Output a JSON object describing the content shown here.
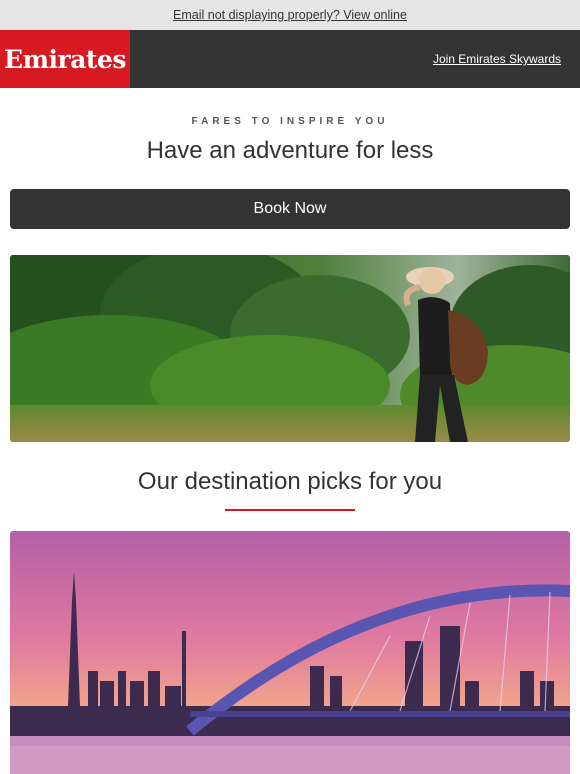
{
  "preheader": {
    "view_online_text": "Email not displaying properly? View online"
  },
  "header": {
    "logo_text": "Emirates",
    "join_link": "Join Emirates Skywards"
  },
  "intro": {
    "eyebrow": "FARES TO INSPIRE YOU",
    "headline": "Have an adventure for less",
    "book_button": "Book Now"
  },
  "destinations": {
    "title": "Our destination picks for you"
  },
  "colors": {
    "brand_red": "#d71921",
    "dark": "#333333",
    "preheader_bg": "#e6e6e6"
  }
}
